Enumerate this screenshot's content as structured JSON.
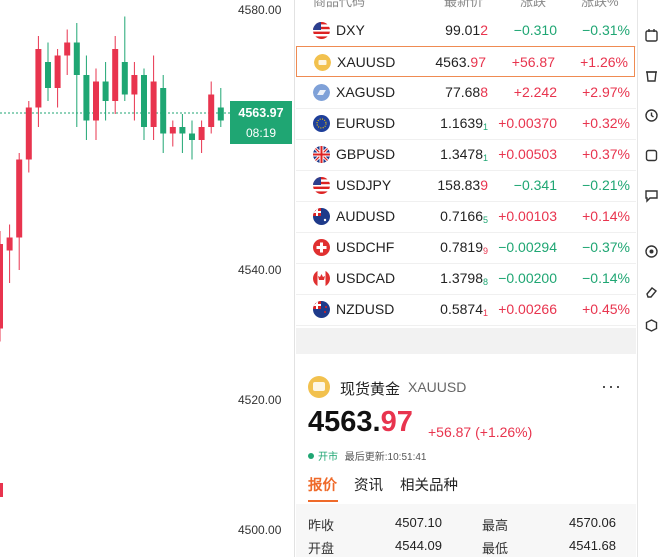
{
  "chart": {
    "axis_labels": [
      "4580.00",
      "4540.00",
      "4520.00",
      "4500.00"
    ],
    "current_price": "4563.97",
    "countdown": "08:19",
    "colors": {
      "up": "#e8344e",
      "down": "#1fa673"
    }
  },
  "list": {
    "headers": [
      "商品代码",
      "最新价",
      "涨跌",
      "涨跌%"
    ],
    "items": [
      {
        "sym": "DXY",
        "price_main": "99.01",
        "price_tail": "2",
        "tail_small": false,
        "tail_dir": "up",
        "chg": "−0.310",
        "chg_dir": "down",
        "pct": "−0.31%",
        "pct_dir": "down",
        "flag": "us-flag-icon"
      },
      {
        "sym": "XAUUSD",
        "price_main": "4563.",
        "price_tail": "97",
        "tail_small": false,
        "tail_dir": "up",
        "chg": "+56.87",
        "chg_dir": "up",
        "pct": "+1.26%",
        "pct_dir": "up",
        "flag": "gold-coin-icon",
        "active": true
      },
      {
        "sym": "XAGUSD",
        "price_main": "77.68",
        "price_tail": "8",
        "tail_small": false,
        "tail_dir": "up",
        "chg": "+2.242",
        "chg_dir": "up",
        "pct": "+2.97%",
        "pct_dir": "up",
        "flag": "silver-coin-icon"
      },
      {
        "sym": "EURUSD",
        "price_main": "1.1639",
        "price_tail": "1",
        "tail_small": true,
        "tail_dir": "down",
        "chg": "+0.00370",
        "chg_dir": "up",
        "pct": "+0.32%",
        "pct_dir": "up",
        "flag": "eu-flag-icon"
      },
      {
        "sym": "GBPUSD",
        "price_main": "1.3478",
        "price_tail": "1",
        "tail_small": true,
        "tail_dir": "down",
        "chg": "+0.00503",
        "chg_dir": "up",
        "pct": "+0.37%",
        "pct_dir": "up",
        "flag": "uk-flag-icon"
      },
      {
        "sym": "USDJPY",
        "price_main": "158.83",
        "price_tail": "9",
        "tail_small": false,
        "tail_dir": "up",
        "chg": "−0.341",
        "chg_dir": "down",
        "pct": "−0.21%",
        "pct_dir": "down",
        "flag": "us-flag-icon"
      },
      {
        "sym": "AUDUSD",
        "price_main": "0.7166",
        "price_tail": "5",
        "tail_small": true,
        "tail_dir": "down",
        "chg": "+0.00103",
        "chg_dir": "up",
        "pct": "+0.14%",
        "pct_dir": "up",
        "flag": "au-flag-icon"
      },
      {
        "sym": "USDCHF",
        "price_main": "0.7819",
        "price_tail": "9",
        "tail_small": true,
        "tail_dir": "up",
        "chg": "−0.00294",
        "chg_dir": "down",
        "pct": "−0.37%",
        "pct_dir": "down",
        "flag": "ch-flag-icon"
      },
      {
        "sym": "USDCAD",
        "price_main": "1.3798",
        "price_tail": "8",
        "tail_small": true,
        "tail_dir": "down",
        "chg": "−0.00200",
        "chg_dir": "down",
        "pct": "−0.14%",
        "pct_dir": "down",
        "flag": "ca-flag-icon"
      },
      {
        "sym": "NZDUSD",
        "price_main": "0.5874",
        "price_tail": "1",
        "tail_small": true,
        "tail_dir": "up",
        "chg": "+0.00266",
        "chg_dir": "up",
        "pct": "+0.45%",
        "pct_dir": "up",
        "flag": "nz-flag-icon"
      }
    ]
  },
  "detail": {
    "name": "现货黄金",
    "symbol": "XAUUSD",
    "more": "···",
    "price_int": "4563.",
    "price_dec": "97",
    "change": "+56.87 (+1.26%)",
    "market_status": "开市",
    "updated": "最后更新:10:51:41",
    "tabs": [
      "报价",
      "资讯",
      "相关品种"
    ],
    "stats": {
      "prev_close_label": "昨收",
      "prev_close": "4507.10",
      "open_label": "开盘",
      "open": "4544.09",
      "high_label": "最高",
      "high": "4570.06",
      "low_label": "最低",
      "low": "4541.68"
    }
  },
  "toolbar": {
    "icons": [
      "calendar-icon",
      "trash-icon",
      "clock-icon",
      "settings-icon",
      "square-icon",
      "message-icon",
      "target-icon",
      "eraser-icon",
      "cube-icon"
    ]
  }
}
